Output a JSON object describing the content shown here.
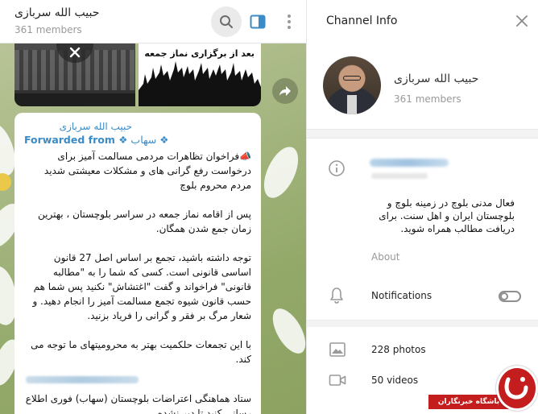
{
  "chat": {
    "title": "حبیب الله سربازی",
    "members": "361 members",
    "photo_caption": "بعد از برگزاری نماز جمعه",
    "message": {
      "sender": "حبیب الله سربازی",
      "forwarded_prefix": "Forwarded from",
      "forwarded_source": "❖ سهاب ❖",
      "paragraphs": [
        "📣فراخوان تظاهرات مردمی مسالمت آمیز برای درخواست رفع گرانی های و مشکلات معیشتی شدید مردم محروم بلوچ",
        "پس از اقامه نماز جمعه در سراسر بلوچستان ، بهترین زمان جمع شدن همگان.",
        "توجه داشته باشید، تجمع بر اساس اصل 27 قانون اساسی قانونی است. کسی که شما را به \"مطالبه قانونی\" فراخواند و گفت \"اغتشاش\" نکنید پس شما هم حسب قانون شیوه تجمع مسالمت آمیز را انجام دهید. و شعار مرگ بر فقر و گرانی را فریاد بزنید.",
        "با این تجمعات حلکمیت بهتر به محرومیتهای ما توجه می کند."
      ],
      "closing": "ستاد هماهنگی اعتراضات بلوچستان (سهاب) فوری اطلاع رسانی کنید تا دیر نشده."
    }
  },
  "info": {
    "title": "Channel Info",
    "name": "حبیب الله سربازی",
    "members": "361 members",
    "about_text": "فعال مدنی بلوچ در زمینه بلوچ و بلوچستان ایران و اهل سنت. برای دریافت مطالب همراه شوید.",
    "about_label": "About",
    "notifications_label": "Notifications",
    "notifications_enabled": false,
    "photos": "228 photos",
    "videos": "50 videos"
  },
  "watermark": {
    "text": "باشگاه خبرنگاران",
    "color": "#c41d1d"
  },
  "colors": {
    "link": "#3a8bc6",
    "accent_toggle": "#8f8f8f"
  }
}
